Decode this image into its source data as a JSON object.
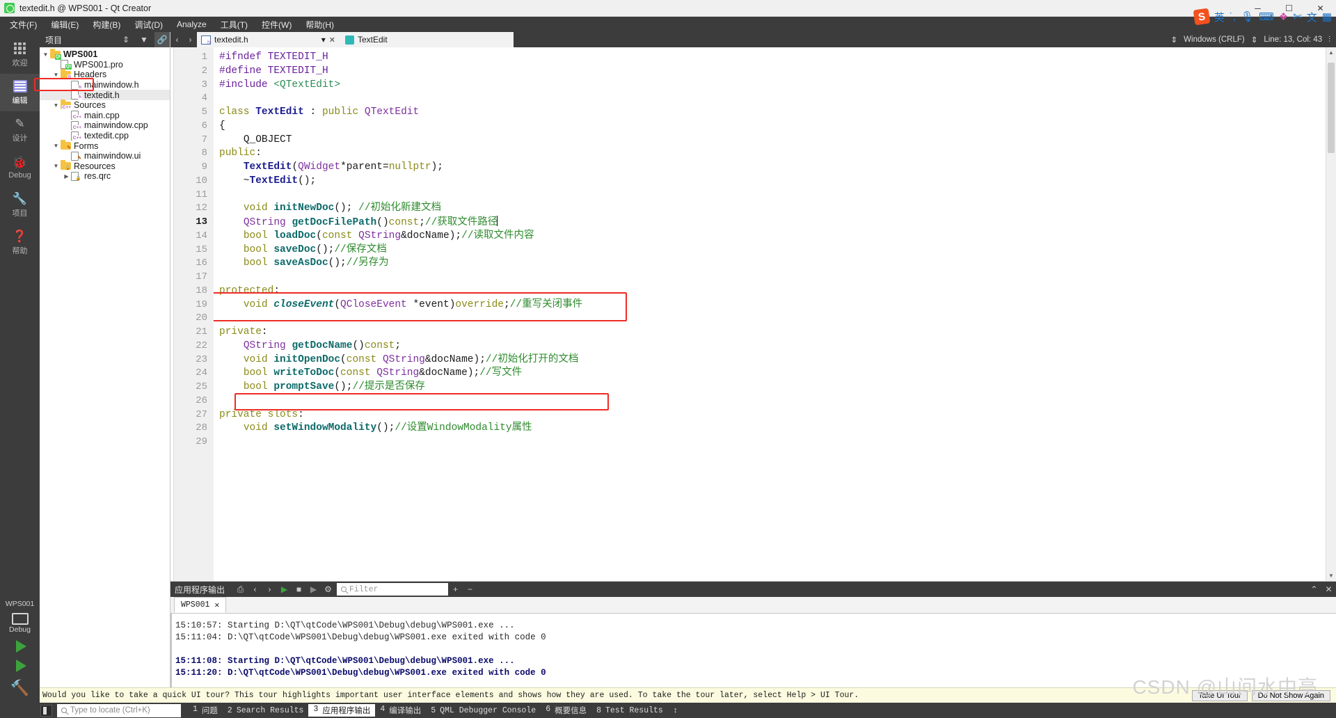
{
  "window": {
    "title": "textedit.h @ WPS001 - Qt Creator",
    "minimize": "─",
    "maximize": "☐",
    "close": "✕"
  },
  "menubar": [
    {
      "label": "文件(F)"
    },
    {
      "label": "编辑(E)"
    },
    {
      "label": "构建(B)"
    },
    {
      "label": "调试(D)"
    },
    {
      "label": "Analyze"
    },
    {
      "label": "工具(T)"
    },
    {
      "label": "控件(W)"
    },
    {
      "label": "帮助(H)"
    }
  ],
  "tray": {
    "ime_label": "英",
    "logo": "S"
  },
  "modes": [
    {
      "label": "欢迎",
      "icon": "grid-icon",
      "active": false
    },
    {
      "label": "编辑",
      "icon": "document-icon",
      "active": true
    },
    {
      "label": "设计",
      "icon": "pencil-icon",
      "active": false
    },
    {
      "label": "Debug",
      "icon": "bug-icon",
      "active": false
    },
    {
      "label": "项目",
      "icon": "wrench-icon",
      "active": false
    },
    {
      "label": "帮助",
      "icon": "question-icon",
      "active": false
    }
  ],
  "kit_selector": {
    "project": "WPS001",
    "config": "Debug"
  },
  "project_panel": {
    "title": "项目",
    "tree": [
      {
        "label": "WPS001",
        "depth": 0,
        "arrow": "▼",
        "icon": "qt-folder-icon",
        "bold": true,
        "selected": false
      },
      {
        "label": "WPS001.pro",
        "depth": 1,
        "arrow": "",
        "icon": "qt-file-icon",
        "bold": false,
        "selected": false
      },
      {
        "label": "Headers",
        "depth": 1,
        "arrow": "▼",
        "icon": "h-folder-icon",
        "bold": false,
        "selected": false
      },
      {
        "label": "mainwindow.h",
        "depth": 2,
        "arrow": "",
        "icon": "h-file-icon",
        "bold": false,
        "selected": false
      },
      {
        "label": "textedit.h",
        "depth": 2,
        "arrow": "",
        "icon": "h-file-icon",
        "bold": false,
        "selected": true
      },
      {
        "label": "Sources",
        "depth": 1,
        "arrow": "▼",
        "icon": "cpp-folder-icon",
        "bold": false,
        "selected": false
      },
      {
        "label": "main.cpp",
        "depth": 2,
        "arrow": "",
        "icon": "cpp-file-icon",
        "bold": false,
        "selected": false
      },
      {
        "label": "mainwindow.cpp",
        "depth": 2,
        "arrow": "",
        "icon": "cpp-file-icon",
        "bold": false,
        "selected": false
      },
      {
        "label": "textedit.cpp",
        "depth": 2,
        "arrow": "",
        "icon": "cpp-file-icon",
        "bold": false,
        "selected": false
      },
      {
        "label": "Forms",
        "depth": 1,
        "arrow": "▼",
        "icon": "ui-folder-icon",
        "bold": false,
        "selected": false
      },
      {
        "label": "mainwindow.ui",
        "depth": 2,
        "arrow": "",
        "icon": "ui-file-icon",
        "bold": false,
        "selected": false
      },
      {
        "label": "Resources",
        "depth": 1,
        "arrow": "▼",
        "icon": "qrc-folder-icon",
        "bold": false,
        "selected": false
      },
      {
        "label": "res.qrc",
        "depth": 2,
        "arrow": "▶",
        "icon": "qrc-file-icon",
        "bold": false,
        "selected": false
      }
    ]
  },
  "editor_tabbar": {
    "file_tab": "textedit.h",
    "close_glyph": "✕",
    "dropdown_glyph": "▾",
    "symbol": "TextEdit",
    "line_ending": "Windows (CRLF)",
    "cursor_pos": "Line: 13, Col: 43"
  },
  "code": {
    "lines": [
      {
        "n": 1,
        "fold": false,
        "changed": false,
        "current": false
      },
      {
        "n": 2,
        "fold": false,
        "changed": false,
        "current": false
      },
      {
        "n": 3,
        "fold": false,
        "changed": false,
        "current": false
      },
      {
        "n": 4,
        "fold": false,
        "changed": false,
        "current": false
      },
      {
        "n": 5,
        "fold": true,
        "changed": false,
        "current": false
      },
      {
        "n": 6,
        "fold": false,
        "changed": false,
        "current": false
      },
      {
        "n": 7,
        "fold": false,
        "changed": false,
        "current": false
      },
      {
        "n": 8,
        "fold": false,
        "changed": false,
        "current": false
      },
      {
        "n": 9,
        "fold": false,
        "changed": false,
        "current": false
      },
      {
        "n": 10,
        "fold": false,
        "changed": false,
        "current": false
      },
      {
        "n": 11,
        "fold": false,
        "changed": false,
        "current": false
      },
      {
        "n": 12,
        "fold": false,
        "changed": false,
        "current": false
      },
      {
        "n": 13,
        "fold": false,
        "changed": false,
        "current": true
      },
      {
        "n": 14,
        "fold": false,
        "changed": false,
        "current": false
      },
      {
        "n": 15,
        "fold": false,
        "changed": true,
        "current": false
      },
      {
        "n": 16,
        "fold": false,
        "changed": true,
        "current": false
      },
      {
        "n": 17,
        "fold": false,
        "changed": true,
        "current": false
      },
      {
        "n": 18,
        "fold": false,
        "changed": true,
        "current": false
      },
      {
        "n": 19,
        "fold": false,
        "changed": true,
        "current": false
      },
      {
        "n": 20,
        "fold": false,
        "changed": false,
        "current": false
      },
      {
        "n": 21,
        "fold": false,
        "changed": false,
        "current": false
      },
      {
        "n": 22,
        "fold": false,
        "changed": true,
        "current": false
      },
      {
        "n": 23,
        "fold": false,
        "changed": false,
        "current": false
      },
      {
        "n": 24,
        "fold": false,
        "changed": true,
        "current": false
      },
      {
        "n": 25,
        "fold": false,
        "changed": true,
        "current": false
      },
      {
        "n": 26,
        "fold": false,
        "changed": false,
        "current": false
      },
      {
        "n": 27,
        "fold": false,
        "changed": false,
        "current": false
      },
      {
        "n": 28,
        "fold": false,
        "changed": false,
        "current": false
      },
      {
        "n": 29,
        "fold": false,
        "changed": false,
        "current": false
      }
    ],
    "text": [
      "#ifndef TEXTEDIT_H",
      "#define TEXTEDIT_H",
      "#include <QTextEdit>",
      "",
      "class TextEdit : public QTextEdit",
      "{",
      "    Q_OBJECT",
      "public:",
      "    TextEdit(QWidget*parent=nullptr);",
      "    ~TextEdit();",
      "",
      "    void initNewDoc(); //初始化新建文档",
      "    QString getDocFilePath()const;//获取文件路径",
      "    bool loadDoc(const QString&docName);//读取文件内容",
      "    bool saveDoc();//保存文档",
      "    bool saveAsDoc();//另存为",
      "",
      "protected:",
      "    void closeEvent(QCloseEvent *event)override;//重写关闭事件",
      "",
      "private:",
      "    QString getDocName()const;",
      "    void initOpenDoc(const QString&docName);//初始化打开的文档",
      "    bool writeToDoc(const QString&docName);//写文件",
      "    bool promptSave();//提示是否保存",
      "",
      "private slots:",
      "    void setWindowModality();//设置WindowModality属性",
      ""
    ],
    "annotations": [
      {
        "name": "closeEvent-highlight",
        "lines": "18-19"
      },
      {
        "name": "promptSave-highlight",
        "lines": "25"
      }
    ]
  },
  "output_pane": {
    "title": "应用程序输出",
    "filter_placeholder": "Filter",
    "tab": "WPS001",
    "tab_close": "✕",
    "add_glyph": "+",
    "remove_glyph": "−",
    "lines": [
      {
        "text": "15:10:57: Starting D:\\QT\\qtCode\\WPS001\\Debug\\debug\\WPS001.exe ...",
        "bold": false
      },
      {
        "text": "15:11:04: D:\\QT\\qtCode\\WPS001\\Debug\\debug\\WPS001.exe exited with code 0",
        "bold": false
      },
      {
        "text": "",
        "bold": false
      },
      {
        "text": "15:11:08: Starting D:\\QT\\qtCode\\WPS001\\Debug\\debug\\WPS001.exe ...",
        "bold": true
      },
      {
        "text": "15:11:20: D:\\QT\\qtCode\\WPS001\\Debug\\debug\\WPS001.exe exited with code 0",
        "bold": true
      }
    ]
  },
  "tour_banner": {
    "text": "Would you like to take a quick UI tour? This tour highlights important user interface elements and shows how they are used. To take the tour later, select Help > UI Tour.",
    "take_tour": "Take UI Tour",
    "do_not_show": "Do Not Show Again"
  },
  "statusbar": {
    "locate_placeholder": "Type to locate (Ctrl+K)",
    "items": [
      {
        "num": "1",
        "label": "问题",
        "active": false
      },
      {
        "num": "2",
        "label": "Search Results",
        "active": false
      },
      {
        "num": "3",
        "label": "应用程序输出",
        "active": true
      },
      {
        "num": "4",
        "label": "编译输出",
        "active": false
      },
      {
        "num": "5",
        "label": "QML Debugger Console",
        "active": false
      },
      {
        "num": "6",
        "label": "概要信息",
        "active": false
      },
      {
        "num": "8",
        "label": "Test Results",
        "active": false
      }
    ],
    "resize_glyph": "↕"
  },
  "watermark": "CSDN @山间水中亭",
  "colors": {
    "accent_red": "#ee2b24",
    "qt_green": "#41cd52",
    "dark_chrome": "#3c3c3c",
    "change_marker": "#1f9b33"
  }
}
